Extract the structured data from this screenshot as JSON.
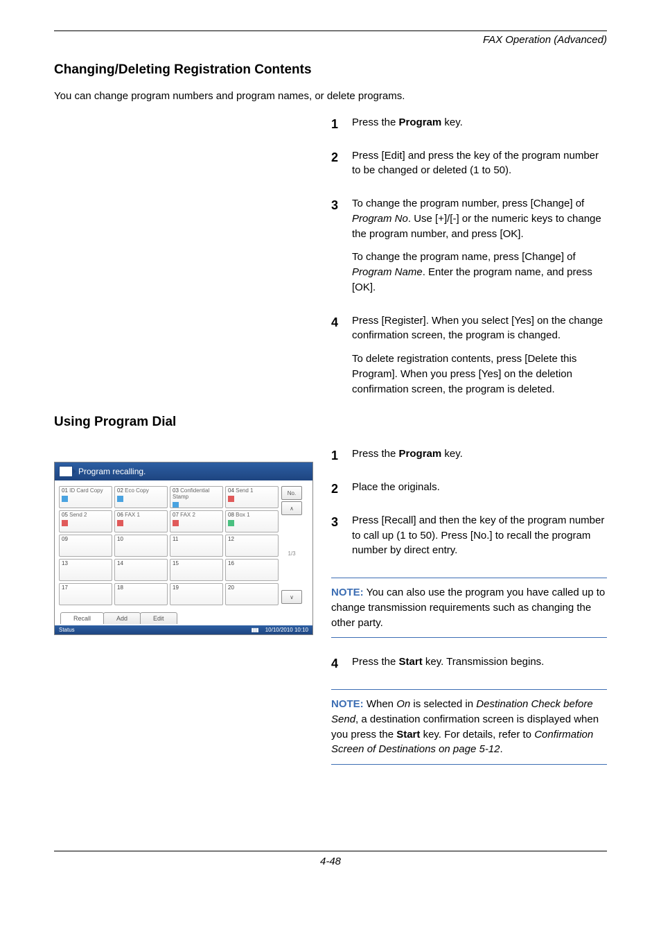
{
  "running_head": "FAX Operation (Advanced)",
  "section1": {
    "title": "Changing/Deleting Registration Contents",
    "intro": "You can change program numbers and program names, or delete programs."
  },
  "steps1": {
    "s1": {
      "pre": "Press the ",
      "bold": "Program",
      "post": " key."
    },
    "s2": "Press [Edit] and press the key of the program number to be changed or deleted (1 to 50).",
    "s3a": {
      "pre": "To change the program number, press [Change] of ",
      "ital": "Program No",
      "post": ". Use [+]/[-] or the numeric keys to change the program number, and press [OK]."
    },
    "s3b": {
      "pre": "To change the program name, press [Change] of ",
      "ital": "Program Name",
      "post": ". Enter the program name, and press [OK]."
    },
    "s4a": "Press [Register]. When you select [Yes] on the change confirmation screen, the program is changed.",
    "s4b": "To delete registration contents, press [Delete this Program]. When you press [Yes] on the deletion confirmation screen, the program is deleted."
  },
  "section2": {
    "title": "Using Program Dial"
  },
  "steps2": {
    "s1": {
      "pre": "Press the ",
      "bold": "Program",
      "post": " key."
    },
    "s2": "Place the originals.",
    "s3": "Press [Recall] and then the key of the program number to call up (1 to 50). Press [No.] to recall the program number by direct entry.",
    "s4": {
      "pre": "Press the ",
      "bold": "Start",
      "post": " key. Transmission begins."
    }
  },
  "note1": {
    "label": "NOTE:",
    "text": " You can also use the program you have called up to change transmission requirements such as changing the other party."
  },
  "note2": {
    "label": "NOTE:",
    "p1a": " When ",
    "ital1": "On",
    "p1b": " is selected in ",
    "ital2": "Destination Check before Send",
    "p1c": ", a destination confirmation screen is displayed when you press the ",
    "bold": "Start",
    "p1d": " key. For details, refer to ",
    "ital3": "Confirmation Screen of Destinations on page 5-12",
    "p1e": "."
  },
  "screenshot": {
    "title": "Program recalling.",
    "cells": [
      {
        "n": "01",
        "t": "ID Card Copy",
        "ico": "copy"
      },
      {
        "n": "02",
        "t": "Eco Copy",
        "ico": "copy"
      },
      {
        "n": "03",
        "t": "Confidential Stamp",
        "ico": "copy"
      },
      {
        "n": "04",
        "t": "Send 1",
        "ico": "send"
      },
      {
        "n": "05",
        "t": "Send 2",
        "ico": "send"
      },
      {
        "n": "06",
        "t": "FAX 1",
        "ico": "fax"
      },
      {
        "n": "07",
        "t": "FAX 2",
        "ico": "fax"
      },
      {
        "n": "08",
        "t": "Box 1",
        "ico": "box"
      },
      {
        "n": "09",
        "t": "",
        "ico": ""
      },
      {
        "n": "10",
        "t": "",
        "ico": ""
      },
      {
        "n": "11",
        "t": "",
        "ico": ""
      },
      {
        "n": "12",
        "t": "",
        "ico": ""
      },
      {
        "n": "13",
        "t": "",
        "ico": ""
      },
      {
        "n": "14",
        "t": "",
        "ico": ""
      },
      {
        "n": "15",
        "t": "",
        "ico": ""
      },
      {
        "n": "16",
        "t": "",
        "ico": ""
      },
      {
        "n": "17",
        "t": "",
        "ico": ""
      },
      {
        "n": "18",
        "t": "",
        "ico": ""
      },
      {
        "n": "19",
        "t": "",
        "ico": ""
      },
      {
        "n": "20",
        "t": "",
        "ico": ""
      }
    ],
    "side": {
      "no": "No.",
      "up": "∧",
      "page": "1/3",
      "down": "∨"
    },
    "tabs": {
      "recall": "Recall",
      "add": "Add",
      "edit": "Edit"
    },
    "status": {
      "label": "Status",
      "icons": "▮▮▮",
      "time": "10/10/2010  10:10"
    }
  },
  "page_num": "4-48"
}
